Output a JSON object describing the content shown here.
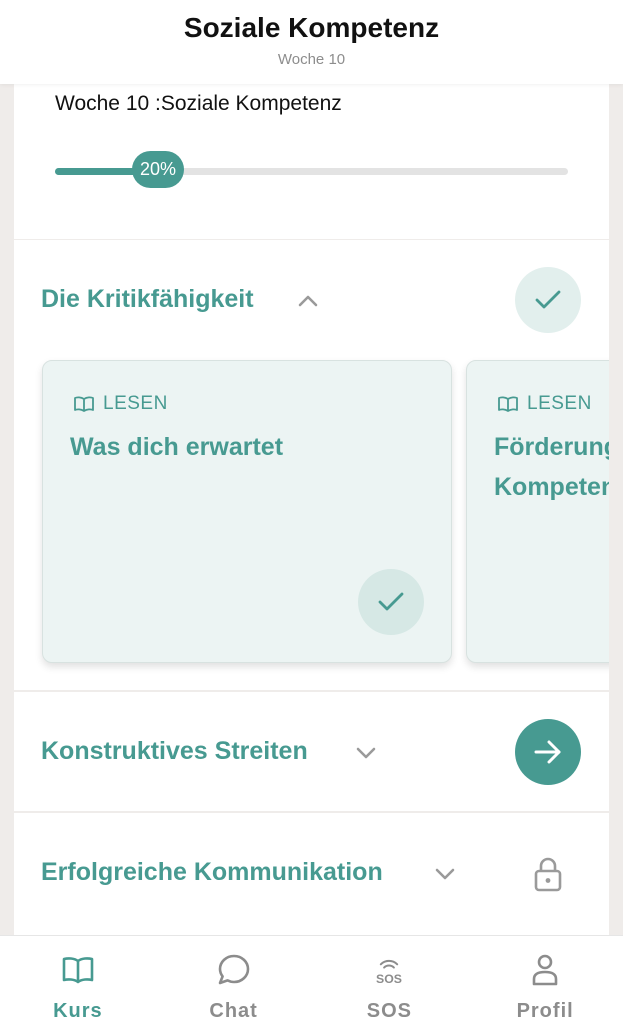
{
  "header": {
    "title": "Soziale Kompetenz",
    "subtitle": "Woche 10"
  },
  "progress": {
    "title": "Woche 10 :Soziale Kompetenz",
    "label": "20%",
    "value": 0.2
  },
  "sections": [
    {
      "title": "Die Kritikfähigkeit",
      "expanded": true,
      "status": "completed",
      "cards": [
        {
          "tag": "LESEN",
          "title": "Was dich erwartet",
          "completed": true,
          "icon": "book-open-icon"
        },
        {
          "tag": "LESEN",
          "title": "Förderung\nKompeten",
          "completed": false,
          "icon": "book-open-icon"
        }
      ]
    },
    {
      "title": "Konstruktives Streiten",
      "expanded": false,
      "status": "next"
    },
    {
      "title": "Erfolgreiche Kommunikation",
      "expanded": false,
      "status": "locked"
    }
  ],
  "tabs": [
    {
      "label": "Kurs",
      "icon": "book-icon",
      "active": true
    },
    {
      "label": "Chat",
      "icon": "chat-bubble-icon",
      "active": false
    },
    {
      "label": "SOS",
      "icon": "sos-icon",
      "icon_text": "SOS",
      "active": false
    },
    {
      "label": "Profil",
      "icon": "person-icon",
      "active": false
    }
  ],
  "colors": {
    "accent": "#479a91",
    "accent_light": "#e2efed",
    "inactive": "#8c8c8c"
  }
}
